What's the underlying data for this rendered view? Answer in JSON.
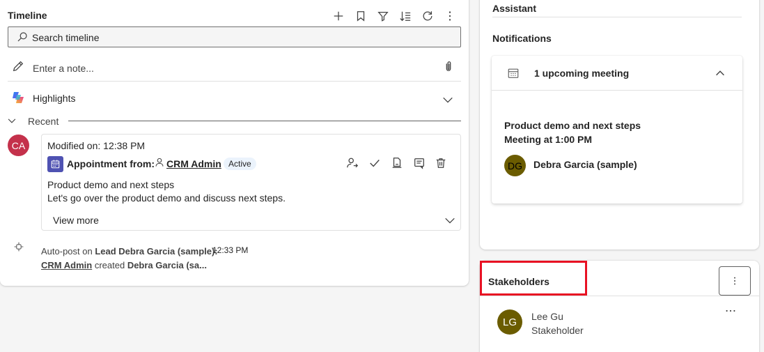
{
  "timeline": {
    "title": "Timeline",
    "search_placeholder": "Search timeline",
    "note_placeholder": "Enter a note...",
    "highlights_label": "Highlights",
    "recent_label": "Recent",
    "activity": {
      "avatar_initials": "CA",
      "modified": "Modified on: 12:38 PM",
      "type_label": "Appointment from:",
      "owner": "CRM Admin",
      "status": "Active",
      "line1": "Product demo and next steps",
      "line2": "Let's go over the product demo and discuss next steps.",
      "view_more": "View more"
    },
    "autopost": {
      "prefix": "Auto-post on",
      "subject": "Lead Debra Garcia (sample):",
      "time": "12:33 PM",
      "actor": "CRM Admin",
      "verb": "created",
      "object": "Debra Garcia (sa..."
    }
  },
  "right_panel": {
    "assistant_label": "Assistant",
    "notifications_title": "Notifications",
    "meeting_count": "1 upcoming meeting",
    "meeting_title": "Product demo and next steps",
    "meeting_time": "Meeting at 1:00 PM",
    "attendee_initials": "DG",
    "attendee_name": "Debra Garcia (sample)"
  },
  "stakeholders": {
    "title": "Stakeholders",
    "items": [
      {
        "initials": "LG",
        "name": "Lee Gu",
        "role": "Stakeholder"
      }
    ]
  },
  "colors": {
    "highlight_border": "#e81123",
    "ca_avatar": "#c4314b",
    "appointment_badge": "#4f52b2",
    "olive_avatar": "#6b5c00"
  }
}
